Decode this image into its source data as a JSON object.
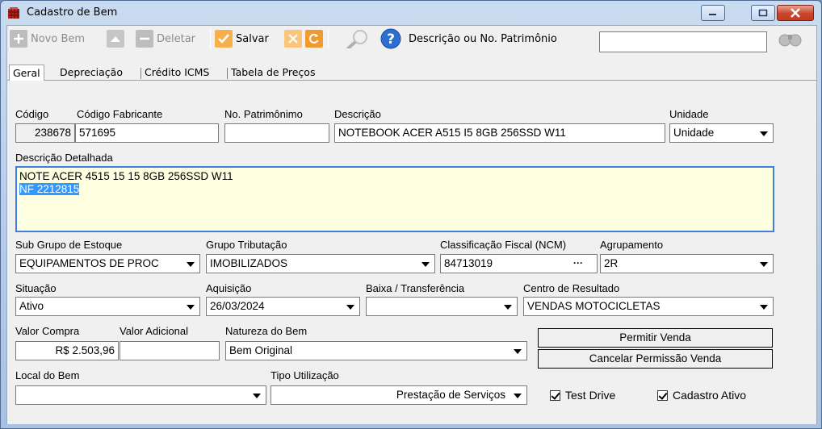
{
  "window": {
    "title": "Cadastro de Bem"
  },
  "toolbar": {
    "new_label": "Novo Bem",
    "delete_label": "Deletar",
    "save_label": "Salvar",
    "search_label": "Descrição ou No. Patrimônio",
    "search_value": ""
  },
  "tabs": [
    "Geral",
    "Depreciação",
    "Crédito ICMS",
    "Tabela de Preços"
  ],
  "form": {
    "codigo": {
      "label": "Código",
      "value": "238678"
    },
    "codigo_fabricante": {
      "label": "Código Fabricante",
      "value": "571695"
    },
    "no_patrimonio": {
      "label": "No. Patrimônimo",
      "value": ""
    },
    "descricao": {
      "label": "Descrição",
      "value": "NOTEBOOK ACER A515 I5 8GB 256SSD W11"
    },
    "unidade": {
      "label": "Unidade",
      "value": "Unidade"
    },
    "descricao_detalhada": {
      "label": "Descrição Detalhada",
      "line1": "NOTE ACER 4515 15 15 8GB 256SSD W11",
      "line2": "NF 2212815"
    },
    "sub_grupo": {
      "label": "Sub Grupo de Estoque",
      "value": "EQUIPAMENTOS DE PROC"
    },
    "grupo_tributacao": {
      "label": "Grupo Tributação",
      "value": "IMOBILIZADOS"
    },
    "ncm": {
      "label": "Classificação Fiscal (NCM)",
      "value": "84713019",
      "ellipsis": "···"
    },
    "agrupamento": {
      "label": "Agrupamento",
      "value": "2R"
    },
    "situacao": {
      "label": "Situação",
      "value": "Ativo"
    },
    "aquisicao": {
      "label": "Aquisição",
      "value": "26/03/2024"
    },
    "baixa": {
      "label": "Baixa / Transferência",
      "value": ""
    },
    "centro_resultado": {
      "label": "Centro de Resultado",
      "value": "VENDAS MOTOCICLETAS"
    },
    "valor_compra": {
      "label": "Valor Compra",
      "value": "R$ 2.503,96"
    },
    "valor_adicional": {
      "label": "Valor Adicional",
      "value": ""
    },
    "natureza": {
      "label": "Natureza do Bem",
      "value": "Bem Original"
    },
    "local": {
      "label": "Local do Bem",
      "value": ""
    },
    "tipo_utilizacao": {
      "label": "Tipo Utilização",
      "value": "Prestação de Serviços"
    },
    "permitir_venda": "Permitir Venda",
    "cancelar_permissao": "Cancelar Permissão Venda",
    "test_drive": {
      "label": "Test Drive",
      "checked": true
    },
    "cadastro_ativo": {
      "label": "Cadastro Ativo",
      "checked": true
    }
  }
}
